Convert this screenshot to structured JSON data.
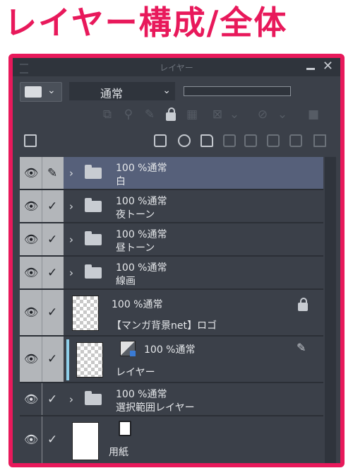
{
  "heading": "レイヤー構成/全体",
  "panel": {
    "title": "レイヤー",
    "blend_mode": "通常",
    "row2_icons": [
      "clip-icon",
      "ref-layer-icon",
      "selection-source-icon",
      "lock-icon",
      "lock-transparency-icon",
      "mask-icon",
      "ruler-icon",
      "enable-mask-icon"
    ],
    "row3_icons": [
      "new-raster-layer-icon",
      "new-vector-layer-icon",
      "new-folder-icon",
      "transfer-down-icon",
      "merge-down-icon",
      "mask-create-icon",
      "apply-mask-icon",
      "delete-icon"
    ]
  },
  "layers": [
    {
      "line1": "100 %通常",
      "line2": "白",
      "kind": "folder",
      "selected": true,
      "eye_bg": "light",
      "pen": true
    },
    {
      "line1": "100 %通常",
      "line2": "夜トーン",
      "kind": "folder",
      "selected": false,
      "eye_bg": "light"
    },
    {
      "line1": "100 %通常",
      "line2": "昼トーン",
      "kind": "folder",
      "selected": false,
      "eye_bg": "light"
    },
    {
      "line1": "100 %通常",
      "line2": "線画",
      "kind": "folder",
      "selected": false,
      "eye_bg": "light"
    },
    {
      "line1": "100 %通常",
      "line2": "【マンガ背景net】ロゴ",
      "kind": "raster-locked",
      "selected": false,
      "eye_bg": "light"
    },
    {
      "line1": "100 %通常",
      "line2": "レイヤー",
      "kind": "tone-layer",
      "selected": false,
      "eye_bg": "light"
    },
    {
      "line1": "100 %通常",
      "line2": "選択範囲レイヤー",
      "kind": "folder",
      "selected": false,
      "eye_bg": "dark"
    },
    {
      "line1": "",
      "line2": "用紙",
      "kind": "paper",
      "selected": false,
      "eye_bg": "dark"
    }
  ],
  "colors": {
    "accent": "#e8195b",
    "panel_bg": "#3b4049",
    "selected_row": "#56607a"
  }
}
